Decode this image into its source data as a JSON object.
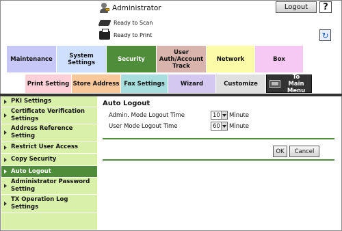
{
  "header": {
    "user_label": "Administrator",
    "logout_label": "Logout",
    "help_label": "?",
    "status_scan": "Ready to Scan",
    "status_print": "Ready to Print",
    "refresh_icon": "↻"
  },
  "tabs": [
    {
      "label": "Maintenance",
      "color": "#c8c8f8",
      "width": 73
    },
    {
      "label": "System Settings",
      "color": "#cfe0ff",
      "width": 73
    },
    {
      "label": "Security",
      "color": "#4f8d3a",
      "width": 73,
      "active": true
    },
    {
      "label": "User Auth/Account Track",
      "color": "#d8b4ac",
      "width": 73
    },
    {
      "label": "Network",
      "color": "#fbfba8",
      "width": 71
    },
    {
      "label": "Box",
      "color": "#f6c8f4",
      "width": 71
    }
  ],
  "subtabs": [
    {
      "label": "Print Setting",
      "color": "#ffd0d8",
      "width": 68
    },
    {
      "label": "Store Address",
      "color": "#f9c89a",
      "width": 72
    },
    {
      "label": "Fax Settings",
      "color": "#a8dede",
      "width": 69
    },
    {
      "label": "Wizard",
      "color": "#d4c8f0",
      "width": 70
    },
    {
      "label": "Customize",
      "color": "#e0e0e0",
      "width": 73
    }
  ],
  "to_main_menu": "To Main Menu",
  "sidebar": [
    {
      "label": "PKI Settings",
      "h": 16
    },
    {
      "label": "Certificate Verification Settings",
      "h": 25
    },
    {
      "label": "Address Reference Setting",
      "h": 25
    },
    {
      "label": "Restrict User Access",
      "h": 18
    },
    {
      "label": "Copy Security",
      "h": 18
    },
    {
      "label": "Auto Logout",
      "h": 17,
      "active": true
    },
    {
      "label": "Administrator Password Setting",
      "h": 25
    },
    {
      "label": "TX Operation Log Settings",
      "h": 27
    }
  ],
  "content": {
    "title": "Auto Logout",
    "admin_label": "Admin. Mode Logout Time",
    "admin_value": "10",
    "user_label": "User Mode Logout Time",
    "user_value": "60",
    "unit": "Minute",
    "ok_label": "OK",
    "cancel_label": "Cancel"
  }
}
